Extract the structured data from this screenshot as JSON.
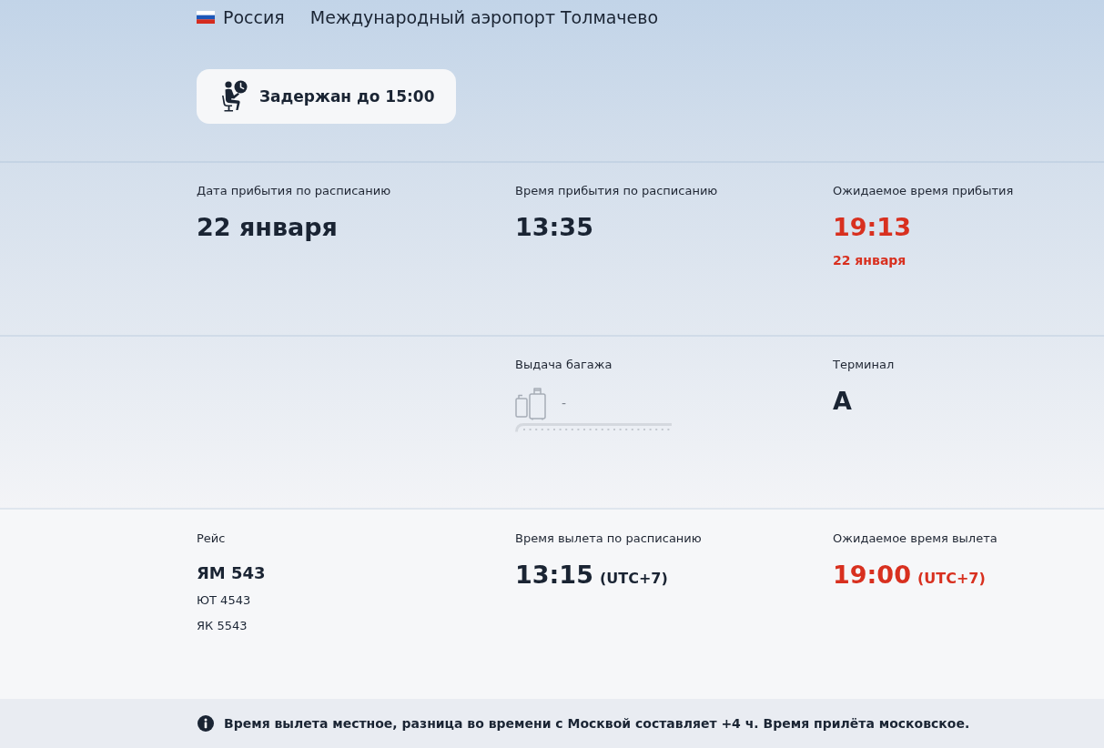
{
  "header": {
    "country": "Россия",
    "airport": "Международный аэропорт Толмачево"
  },
  "status": {
    "text": "Задержан до 15:00"
  },
  "rows": [
    {
      "cells": [
        {
          "kind": "value",
          "label": "Дата прибытия по расписанию",
          "value": "22 января",
          "delayed": false
        },
        {
          "kind": "value",
          "label": "Время прибытия по расписанию",
          "value": "13:35",
          "delayed": false
        },
        {
          "kind": "value",
          "label": "Ожидаемое время прибытия",
          "value": "19:13",
          "date": "22 января",
          "delayed": true
        }
      ]
    },
    {
      "cells": [
        {
          "kind": "baggage",
          "label": "Выдача багажа",
          "value": "-",
          "delayed": false
        },
        {
          "kind": "value",
          "label": "Терминал",
          "value": "А",
          "delayed": false
        }
      ]
    },
    {
      "cells": [
        {
          "kind": "flight",
          "label": "Рейс",
          "value": "ЯМ 543",
          "codeshares": [
            "ЮТ 4543",
            "ЯК 5543"
          ],
          "delayed": false
        },
        {
          "kind": "value",
          "label": "Время вылета по расписанию",
          "value": "13:15",
          "timezone": "(UTC+7)",
          "delayed": false
        },
        {
          "kind": "value",
          "label": "Ожидаемое время вылета",
          "value": "19:00",
          "timezone": "(UTC+7)",
          "delayed": true
        }
      ]
    }
  ],
  "footer": {
    "note": "Время вылета местное, разница во времени с Москвой составляет +4 ч. Время прилёта московское."
  }
}
